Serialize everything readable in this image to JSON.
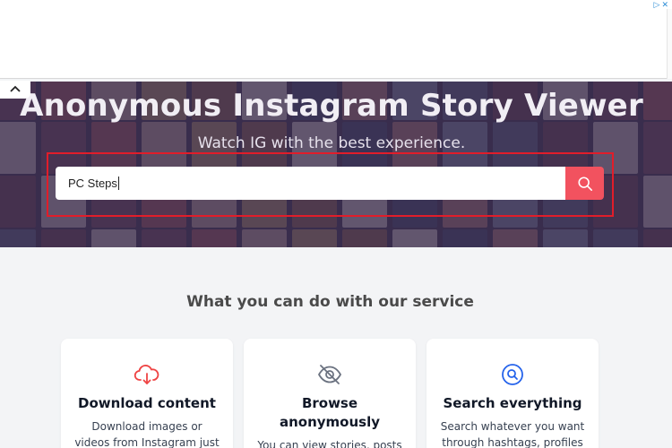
{
  "ad": {
    "marks": [
      "▷",
      "✕"
    ]
  },
  "hero": {
    "title": "Anonymous Instagram Story Viewer",
    "subtitle": "Watch IG with the best experience.",
    "search": {
      "value": "PC Steps",
      "placeholder": ""
    },
    "colors": {
      "accent": "#f2525f",
      "highlight": "#e11d2a",
      "overlay": "#3a2d4e"
    }
  },
  "section": {
    "title": "What you can do with our service"
  },
  "cards": [
    {
      "icon": "cloud-download-icon",
      "title": "Download content",
      "text": "Download images or videos from Instagram just"
    },
    {
      "icon": "eye-off-icon",
      "title_line1": "Browse",
      "title_line2": "anonymously",
      "text": "You can view stories, posts"
    },
    {
      "icon": "search-circle-icon",
      "title": "Search everything",
      "text": "Search whatever you want through hashtags, profiles"
    }
  ]
}
